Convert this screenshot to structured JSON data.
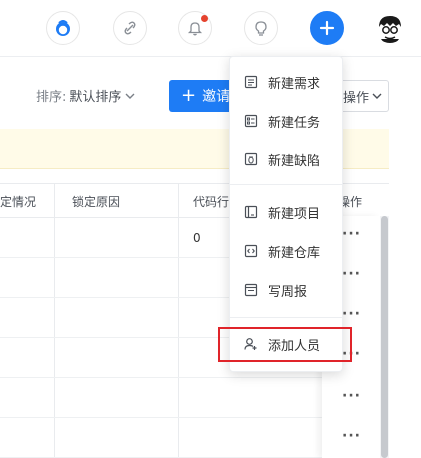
{
  "toolbar": {
    "sort_label": "排序:",
    "sort_value": "默认排序",
    "invite_button": "邀请",
    "ops_button": "操作"
  },
  "table": {
    "headers": [
      "定情况",
      "锁定原因",
      "代码行",
      "操作"
    ],
    "rows": [
      {
        "code_lines": "0",
        "action": "···"
      },
      {
        "code_lines": "",
        "action": "···"
      },
      {
        "code_lines": "",
        "action": "···"
      },
      {
        "code_lines": "",
        "action": "···"
      },
      {
        "code_lines": "",
        "action": "···"
      },
      {
        "code_lines": "",
        "action": "···"
      }
    ]
  },
  "menu": {
    "items": [
      {
        "label": "新建需求",
        "icon": "requirement-icon"
      },
      {
        "label": "新建任务",
        "icon": "task-icon"
      },
      {
        "label": "新建缺陷",
        "icon": "bug-icon"
      },
      {
        "label": "新建项目",
        "icon": "project-icon"
      },
      {
        "label": "新建仓库",
        "icon": "repository-icon"
      },
      {
        "label": "写周报",
        "icon": "weekly-report-icon"
      },
      {
        "label": "添加人员",
        "icon": "add-member-icon"
      }
    ]
  },
  "colors": {
    "primary": "#1e7cf5",
    "notification_dot": "#e5432e",
    "highlight": "#e0242a",
    "notice_bg": "#fffbe8"
  }
}
